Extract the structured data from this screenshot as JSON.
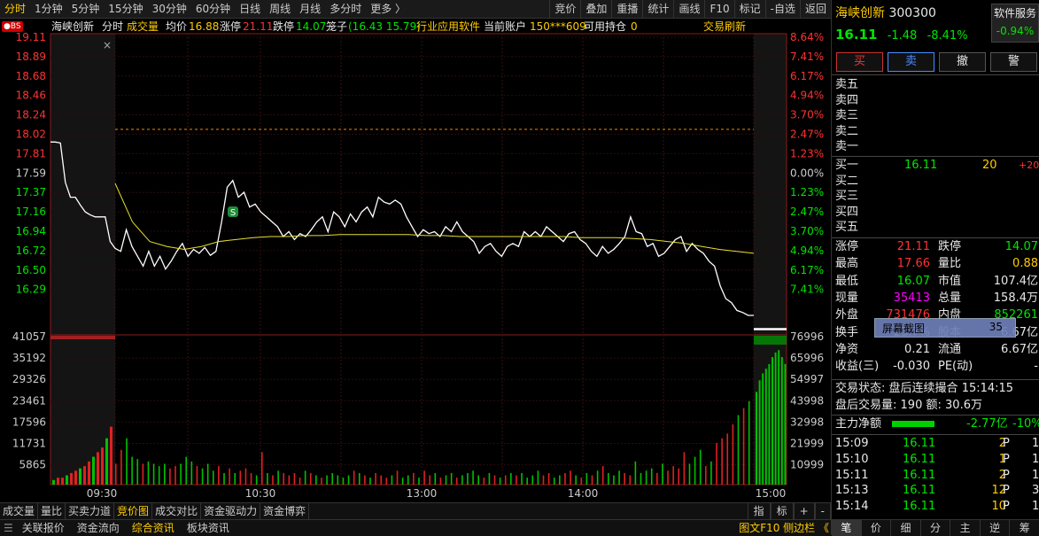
{
  "toolbar": {
    "tabs": [
      "分时",
      "1分钟",
      "5分钟",
      "15分钟",
      "30分钟",
      "60分钟",
      "日线",
      "周线",
      "月线",
      "多分时",
      "更多 〉"
    ],
    "tools": [
      "竞价",
      "叠加",
      "重播",
      "统计",
      "画线",
      "F10",
      "标记",
      "-自选",
      "返回"
    ]
  },
  "info": {
    "stock_name": "海峡创新",
    "mode": "分时",
    "volume_label": "成交量",
    "avg_label": "均价",
    "avg_value": "16.88",
    "limit_up_label": "涨停",
    "limit_up_value": "21.11",
    "limit_down_label": "跌停",
    "limit_down_value": "14.07",
    "basket_label": "笼子",
    "basket_value": "(16.43 15.79)",
    "industry": "行业应用软件",
    "account_label": "当前账户",
    "account_value": "150***609",
    "position_label": "可用持仓",
    "position_value": "0",
    "refresh_label": "交易刷新",
    "bs_badge": "●BS"
  },
  "chart_data": {
    "type": "line",
    "price_axis_labels": [
      "19.11",
      "18.89",
      "18.68",
      "18.46",
      "18.24",
      "18.02",
      "17.81",
      "17.59",
      "17.37",
      "17.16",
      "16.94",
      "16.72",
      "16.50",
      "16.29"
    ],
    "pct_axis_labels": [
      "8.64%",
      "7.41%",
      "6.17%",
      "4.94%",
      "3.70%",
      "2.47%",
      "1.23%",
      "0.00%",
      "1.23%",
      "2.47%",
      "3.70%",
      "4.94%",
      "6.17%",
      "7.41%"
    ],
    "volume_axis_left": [
      "41057",
      "35192",
      "29326",
      "23461",
      "17596",
      "11731",
      "5865"
    ],
    "volume_axis_right": [
      "76996",
      "65996",
      "54997",
      "43998",
      "32998",
      "21999",
      "10999"
    ],
    "time_labels": [
      "09:30",
      "10:30",
      "13:00",
      "14:00",
      "15:00"
    ],
    "ylim": [
      16.07,
      19.11
    ],
    "prev_close": 17.59,
    "price_series": [
      18.01,
      18.01,
      18.0,
      17.6,
      17.45,
      17.45,
      17.37,
      17.3,
      17.27,
      17.25,
      17.25,
      17.25,
      17.0,
      16.93,
      16.9,
      17.12,
      16.95,
      16.85,
      16.75,
      16.9,
      16.75,
      16.85,
      16.72,
      16.8,
      16.9,
      16.98,
      16.85,
      16.92,
      16.88,
      16.94,
      16.86,
      16.9,
      17.2,
      17.55,
      17.62,
      17.45,
      17.5,
      17.35,
      17.38,
      17.3,
      17.25,
      17.2,
      17.15,
      17.05,
      17.1,
      17.02,
      17.08,
      17.05,
      17.12,
      17.2,
      17.25,
      17.1,
      17.3,
      17.25,
      17.15,
      17.28,
      17.2,
      17.3,
      17.35,
      17.25,
      17.45,
      17.4,
      17.38,
      17.42,
      17.38,
      17.25,
      17.15,
      17.05,
      17.12,
      17.08,
      17.1,
      17.05,
      17.15,
      17.1,
      17.2,
      17.1,
      17.05,
      17.0,
      16.88,
      16.95,
      16.98,
      16.9,
      16.85,
      16.95,
      16.98,
      16.95,
      17.1,
      17.05,
      17.1,
      17.05,
      17.15,
      17.1,
      17.05,
      17.0,
      17.08,
      17.1,
      17.02,
      16.98,
      16.9,
      16.85,
      16.95,
      16.88,
      16.92,
      16.98,
      17.05,
      17.25,
      17.1,
      17.08,
      16.95,
      16.98,
      16.85,
      16.88,
      16.95,
      17.02,
      17.05,
      16.9,
      16.98,
      16.92,
      16.88,
      16.8,
      16.75,
      16.55,
      16.42,
      16.38,
      16.3,
      16.28,
      16.25,
      16.25
    ],
    "avg_series": [
      17.59,
      17.2,
      17.0,
      16.95,
      16.92,
      16.95,
      17.0,
      17.02,
      17.04,
      17.05,
      17.05,
      17.06,
      17.06,
      17.07,
      17.07,
      17.07,
      17.07,
      17.07,
      17.06,
      17.06,
      17.05,
      17.05,
      17.05,
      17.05,
      17.05,
      17.05,
      17.05,
      17.04,
      17.04,
      17.04,
      17.03,
      17.02,
      17.0,
      16.98,
      16.95,
      16.92,
      16.9,
      16.88
    ],
    "volume_pre": [
      2,
      3,
      3,
      4,
      5,
      6,
      7,
      8,
      10,
      12,
      14,
      16,
      20,
      25
    ],
    "volume_series": [
      9,
      15,
      20,
      12,
      11,
      9,
      10,
      9,
      8,
      9,
      7,
      8,
      9,
      12,
      10,
      8,
      7,
      9,
      6,
      8,
      5,
      7,
      5,
      6,
      7,
      5,
      4,
      14,
      5,
      4,
      6,
      5,
      4,
      5,
      3,
      6,
      5,
      4,
      3,
      4,
      5,
      4,
      3,
      4,
      6,
      5,
      4,
      3,
      5,
      4,
      3,
      4,
      6,
      3,
      4,
      5,
      3,
      6,
      4,
      5,
      3,
      4,
      5,
      3,
      4,
      5,
      6,
      4,
      3,
      5,
      4,
      3,
      4,
      5,
      4,
      5,
      3,
      4,
      6,
      4,
      5,
      3,
      4,
      5,
      6,
      4,
      3,
      5,
      4,
      6,
      8,
      5,
      4,
      6,
      5,
      4,
      10,
      5,
      6,
      7,
      5,
      9,
      6,
      8,
      7,
      14,
      9,
      12,
      15,
      8,
      10,
      18,
      20,
      22,
      26,
      30,
      33,
      36
    ],
    "volume_tail": [
      40,
      45,
      48,
      50,
      52,
      55,
      57,
      58,
      55,
      52
    ]
  },
  "quote": {
    "name": "海峡创新",
    "code": "300300",
    "price": "16.11",
    "change": "-1.48",
    "change_pct": "-8.41%",
    "sector": "软件服务",
    "sector_pct": "-0.94%",
    "buttons": [
      "买",
      "卖",
      "撤",
      "警"
    ]
  },
  "order_book": {
    "sell": [
      {
        "label": "卖五",
        "price": "",
        "vol": "",
        "chg": ""
      },
      {
        "label": "卖四",
        "price": "",
        "vol": "",
        "chg": ""
      },
      {
        "label": "卖三",
        "price": "",
        "vol": "",
        "chg": ""
      },
      {
        "label": "卖二",
        "price": "",
        "vol": "",
        "chg": ""
      },
      {
        "label": "卖一",
        "price": "",
        "vol": "",
        "chg": ""
      }
    ],
    "buy": [
      {
        "label": "买一",
        "price": "16.11",
        "vol": "20",
        "chg": "+20"
      },
      {
        "label": "买二",
        "price": "",
        "vol": "",
        "chg": ""
      },
      {
        "label": "买三",
        "price": "",
        "vol": "",
        "chg": ""
      },
      {
        "label": "买四",
        "price": "",
        "vol": "",
        "chg": ""
      },
      {
        "label": "买五",
        "price": "",
        "vol": "",
        "chg": ""
      }
    ]
  },
  "stats": [
    {
      "l1": "涨停",
      "v1": "21.11",
      "l2": "跌停",
      "v2": "14.07"
    },
    {
      "l1": "最高",
      "v1": "17.66",
      "l2": "量比",
      "v2": "0.88"
    },
    {
      "l1": "最低",
      "v1": "16.07",
      "l2": "市值",
      "v2": "107.4亿"
    },
    {
      "l1": "现量",
      "v1": "35413",
      "l2": "总量",
      "v2": "158.4万"
    },
    {
      "l1": "外盘",
      "v1": "731476",
      "l2": "内盘",
      "v2": "852261"
    },
    {
      "l1": "换手",
      "v1": "23.7%",
      "l2": "股本",
      "v2": "6.67亿"
    },
    {
      "l1": "净资",
      "v1": "0.21",
      "l2": "流通",
      "v2": "6.67亿"
    },
    {
      "l1": "收益(三)",
      "v1": "-0.030",
      "l2": "PE(动)",
      "v2": "-"
    }
  ],
  "screenshot_overlay": {
    "label": "屏幕截图",
    "value": "35"
  },
  "trade_status": {
    "status_label": "交易状态:",
    "status_value": "盘后连续撮合",
    "time": "15:14:15",
    "after_vol_label": "盘后交易量:",
    "after_vol_value": "190",
    "amount_label": "额:",
    "amount_value": "30.6万",
    "netflow_label": "主力净额",
    "netflow_value": "-2.77亿",
    "netflow_pct": "-10%"
  },
  "ticks": [
    {
      "time": "15:09",
      "price": "16.11",
      "vol": "2",
      "side": "P",
      "n": "1"
    },
    {
      "time": "15:10",
      "price": "16.11",
      "vol": "1",
      "side": "P",
      "n": "1"
    },
    {
      "time": "15:11",
      "price": "16.11",
      "vol": "2",
      "side": "P",
      "n": "1"
    },
    {
      "time": "15:13",
      "price": "16.11",
      "vol": "12",
      "side": "P",
      "n": "3"
    },
    {
      "time": "15:14",
      "price": "16.11",
      "vol": "10",
      "side": "P",
      "n": "1"
    }
  ],
  "bottom_tabs": [
    "成交量",
    "量比",
    "买卖力道",
    "竞价图",
    "成交对比",
    "资金驱动力",
    "资金博弈"
  ],
  "bottom_right": [
    "指",
    "标",
    "+",
    "-"
  ],
  "status_items": [
    "关联报价",
    "资金流向",
    "综合资讯",
    "板块资讯"
  ],
  "status_right": "图文F10 侧边栏 《",
  "rp_tabs": [
    "笔",
    "价",
    "细",
    "分",
    "主",
    "逆",
    "筹"
  ]
}
